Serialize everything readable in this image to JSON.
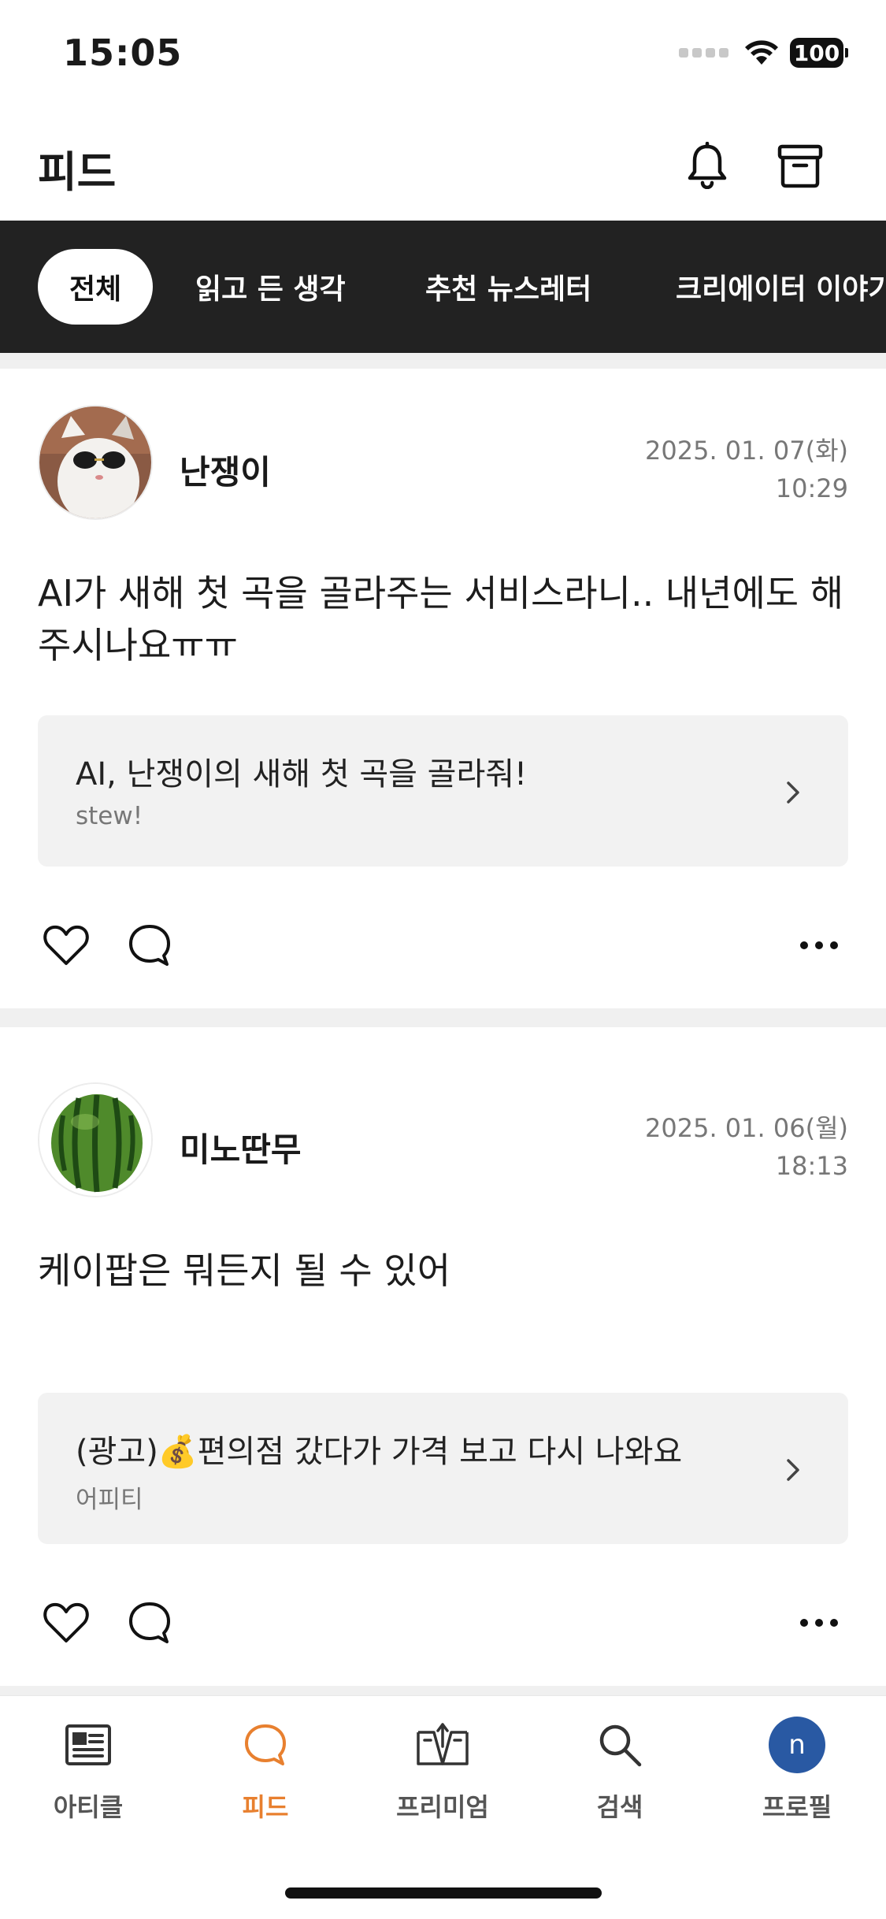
{
  "status_bar": {
    "time": "15:05",
    "battery": "100"
  },
  "header": {
    "title": "피드",
    "icons": [
      "bell-icon",
      "archive-icon"
    ]
  },
  "tabs": [
    {
      "label": "전체",
      "active": true
    },
    {
      "label": "읽고 든 생각",
      "active": false
    },
    {
      "label": "추천 뉴스레터",
      "active": false
    },
    {
      "label": "크리에이터 이야기",
      "active": false
    }
  ],
  "posts": [
    {
      "author": "난쟁이",
      "date": "2025. 01. 07(화)",
      "time": "10:29",
      "content": "AI가 새해 첫 곡을 골라주는 서비스라니.. 내년에도 해주시나요ㅠㅠ",
      "link": {
        "title": "AI, 난쟁이의 새해 첫 곡을 골라줘!",
        "source": "stew!"
      }
    },
    {
      "author": "미노딴무",
      "date": "2025. 01. 06(월)",
      "time": "18:13",
      "content": "케이팝은 뭐든지 될 수 있어",
      "link": {
        "title": "(광고)💰편의점 갔다가 가격 보고 다시 나와요",
        "source": "어피티"
      }
    }
  ],
  "bottom_nav": [
    {
      "label": "아티클",
      "icon": "article-icon",
      "active": false
    },
    {
      "label": "피드",
      "icon": "feed-icon",
      "active": true
    },
    {
      "label": "프리미엄",
      "icon": "premium-icon",
      "active": false
    },
    {
      "label": "검색",
      "icon": "search-icon",
      "active": false
    },
    {
      "label": "프로필",
      "icon": "profile-avatar",
      "avatar_letter": "n",
      "active": false
    }
  ],
  "colors": {
    "accent": "#e8802f",
    "tab_bar": "#222222",
    "profile_avatar": "#2959a3",
    "card_bg": "#f2f2f2"
  }
}
